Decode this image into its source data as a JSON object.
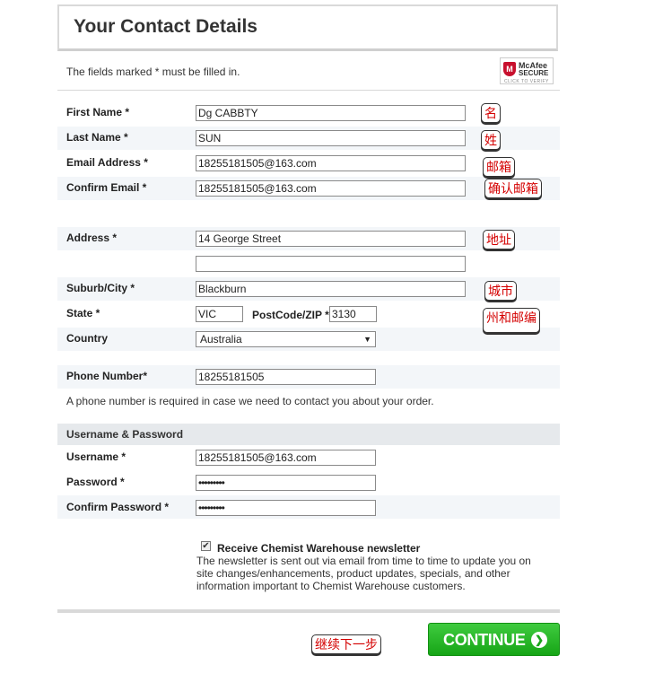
{
  "header": {
    "title": "Your Contact Details"
  },
  "required_note": "The fields marked * must be filled in.",
  "mcafee": {
    "line1": "McAfee",
    "line2": "SECURE",
    "line3": "CLICK TO VERIFY"
  },
  "fields": {
    "first_name": {
      "label": "First Name *",
      "value": "Dg CABBTY",
      "note": "名"
    },
    "last_name": {
      "label": "Last Name *",
      "value": "SUN",
      "note": "姓"
    },
    "email": {
      "label": "Email Address *",
      "value": "18255181505@163.com",
      "note": "邮箱"
    },
    "confirm_email": {
      "label": "Confirm Email *",
      "value": "18255181505@163.com",
      "note": "确认邮箱"
    },
    "address": {
      "label": "Address *",
      "value": "14 George Street",
      "value2": "",
      "note": "地址"
    },
    "suburb": {
      "label": "Suburb/City *",
      "value": "Blackburn",
      "note": "城市"
    },
    "state": {
      "label": "State *",
      "value": "VIC"
    },
    "postcode": {
      "label": "PostCode/ZIP *",
      "value": "3130",
      "note": "州和邮编"
    },
    "country": {
      "label": "Country",
      "value": "Australia"
    },
    "phone": {
      "label": "Phone Number*",
      "value": "18255181505"
    }
  },
  "phone_note": "A phone number is required in case we need to contact you about your order.",
  "account": {
    "section_title": "Username & Password",
    "username": {
      "label": "Username *",
      "value": "18255181505@163.com"
    },
    "password": {
      "label": "Password *",
      "value": "•••••••••"
    },
    "confirm_password": {
      "label": "Confirm Password *",
      "value": "•••••••••"
    }
  },
  "newsletter": {
    "label": "Receive Chemist Warehouse newsletter",
    "checked": true,
    "check_mark": "✔",
    "description": "The newsletter is sent out via email from time to time to update you on site changes/enhancements, product updates, specials, and other information important to Chemist Warehouse customers."
  },
  "footer": {
    "continue_label": "CONTINUE",
    "continue_arrow": "❯",
    "continue_note": "继续下一步"
  },
  "colors": {
    "accent_green": "#16a516",
    "callout_text": "#d40000"
  }
}
